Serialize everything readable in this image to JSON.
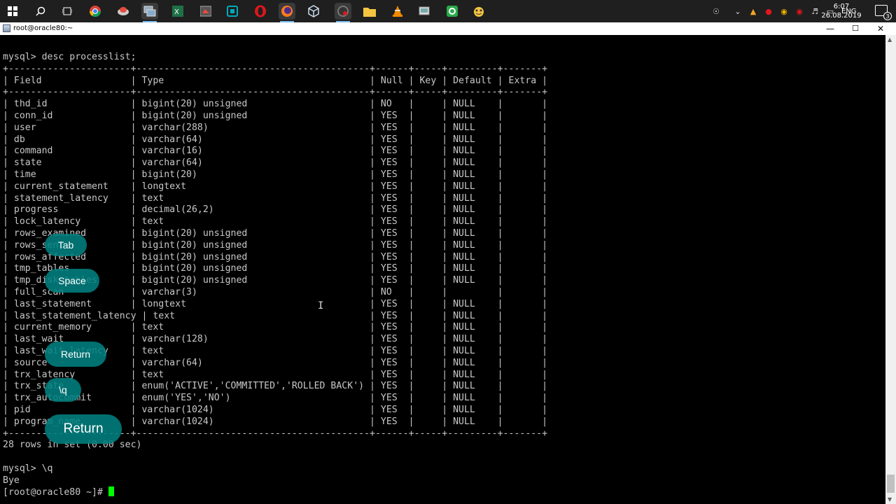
{
  "taskbar": {
    "start_icon": "windows-logo-icon",
    "icons": [
      "search-icon",
      "task-view-icon",
      "chrome-icon",
      "app-icon",
      "putty-icon",
      "excel-icon",
      "app-icon",
      "app-icon",
      "opera-icon",
      "firefox-icon",
      "app-icon",
      "app-icon",
      "folder-icon",
      "vlc-icon",
      "app-icon",
      "app-icon",
      "app-icon"
    ],
    "tray": {
      "language": "ENG",
      "time": "6:07",
      "date": "26.08.2019",
      "notification_count": "3"
    }
  },
  "window": {
    "title": "root@oracle80:~",
    "minimize": "—",
    "maximize": "☐",
    "close": "✕"
  },
  "terminal": {
    "lines": [
      "mysql> desc processlist;",
      "+----------------------+------------------------------------------+------+-----+---------+-------+",
      "| Field                | Type                                     | Null | Key | Default | Extra |",
      "+----------------------+------------------------------------------+------+-----+---------+-------+",
      "| thd_id               | bigint(20) unsigned                      | NO   |     | NULL    |       |",
      "| conn_id              | bigint(20) unsigned                      | YES  |     | NULL    |       |",
      "| user                 | varchar(288)                             | YES  |     | NULL    |       |",
      "| db                   | varchar(64)                              | YES  |     | NULL    |       |",
      "| command              | varchar(16)                              | YES  |     | NULL    |       |",
      "| state                | varchar(64)                              | YES  |     | NULL    |       |",
      "| time                 | bigint(20)                               | YES  |     | NULL    |       |",
      "| current_statement    | longtext                                 | YES  |     | NULL    |       |",
      "| statement_latency    | text                                     | YES  |     | NULL    |       |",
      "| progress             | decimal(26,2)                            | YES  |     | NULL    |       |",
      "| lock_latency         | text                                     | YES  |     | NULL    |       |",
      "| rows_examined        | bigint(20) unsigned                      | YES  |     | NULL    |       |",
      "| rows_sent            | bigint(20) unsigned                      | YES  |     | NULL    |       |",
      "| rows_affected        | bigint(20) unsigned                      | YES  |     | NULL    |       |",
      "| tmp_tables           | bigint(20) unsigned                      | YES  |     | NULL    |       |",
      "| tmp_disk_tables      | bigint(20) unsigned                      | YES  |     | NULL    |       |",
      "| full_scan            | varchar(3)                               | NO   |     |         |       |",
      "| last_statement       | longtext                                 | YES  |     | NULL    |       |",
      "| last_statement_latency | text                                   | YES  |     | NULL    |       |",
      "| current_memory       | text                                     | YES  |     | NULL    |       |",
      "| last_wait            | varchar(128)                             | YES  |     | NULL    |       |",
      "| last_wait_latency    | text                                     | YES  |     | NULL    |       |",
      "| source               | varchar(64)                              | YES  |     | NULL    |       |",
      "| trx_latency          | text                                     | YES  |     | NULL    |       |",
      "| trx_state            | enum('ACTIVE','COMMITTED','ROLLED BACK') | YES  |     | NULL    |       |",
      "| trx_autocommit       | enum('YES','NO')                         | YES  |     | NULL    |       |",
      "| pid                  | varchar(1024)                            | YES  |     | NULL    |       |",
      "| program_name         | varchar(1024)                            | YES  |     | NULL    |       |",
      "+----------------------+------------------------------------------+------+-----+---------+-------+",
      "28 rows in set (0.00 sec)",
      "",
      "mysql> \\q",
      "Bye"
    ],
    "prompt": "[root@oracle80 ~]# "
  },
  "keystrokes": {
    "tab": "Tab",
    "space": "Space",
    "return_1": "Return",
    "backslash_q": "\\q",
    "return_2": "Return"
  }
}
